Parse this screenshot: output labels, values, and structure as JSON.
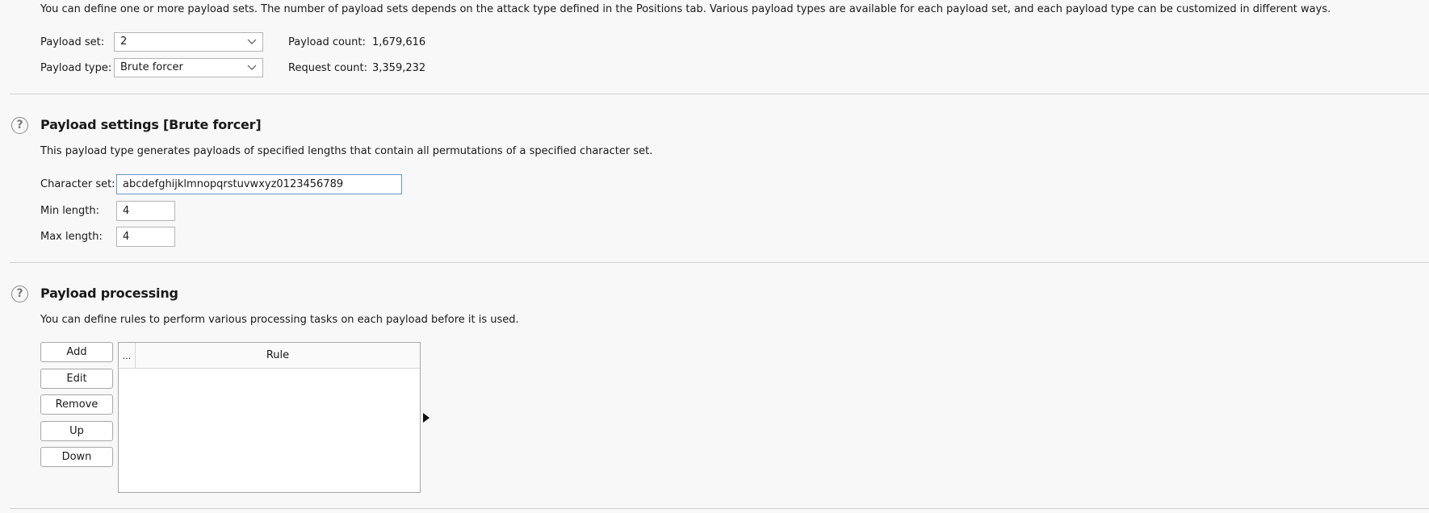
{
  "payload_sets": {
    "description": "You can define one or more payload sets. The number of payload sets depends on the attack type defined in the Positions tab. Various payload types are available for each payload set, and each payload type can be customized in different ways.",
    "payload_set_label": "Payload set:",
    "payload_set_value": "2",
    "payload_type_label": "Payload type:",
    "payload_type_value": "Brute forcer",
    "payload_count_label": "Payload count:",
    "payload_count_value": "1,679,616",
    "request_count_label": "Request count:",
    "request_count_value": "3,359,232"
  },
  "payload_settings": {
    "help_icon": "?",
    "title": "Payload settings [Brute forcer]",
    "description": "This payload type generates payloads of specified lengths that contain all permutations of a specified character set.",
    "character_set_label": "Character set:",
    "character_set_value": "abcdefghijklmnopqrstuvwxyz0123456789",
    "min_length_label": "Min length:",
    "min_length_value": "4",
    "max_length_label": "Max length:",
    "max_length_value": "4"
  },
  "payload_processing": {
    "help_icon": "?",
    "title": "Payload processing",
    "description": "You can define rules to perform various processing tasks on each payload before it is used.",
    "buttons": {
      "add": "Add",
      "edit": "Edit",
      "remove": "Remove",
      "up": "Up",
      "down": "Down"
    },
    "table": {
      "columns": [
        "...",
        "Rule"
      ],
      "rows": []
    }
  },
  "icons": {
    "help": "help-circle-icon",
    "dropdown": "chevron-down-icon",
    "expand": "triangle-right-icon"
  }
}
